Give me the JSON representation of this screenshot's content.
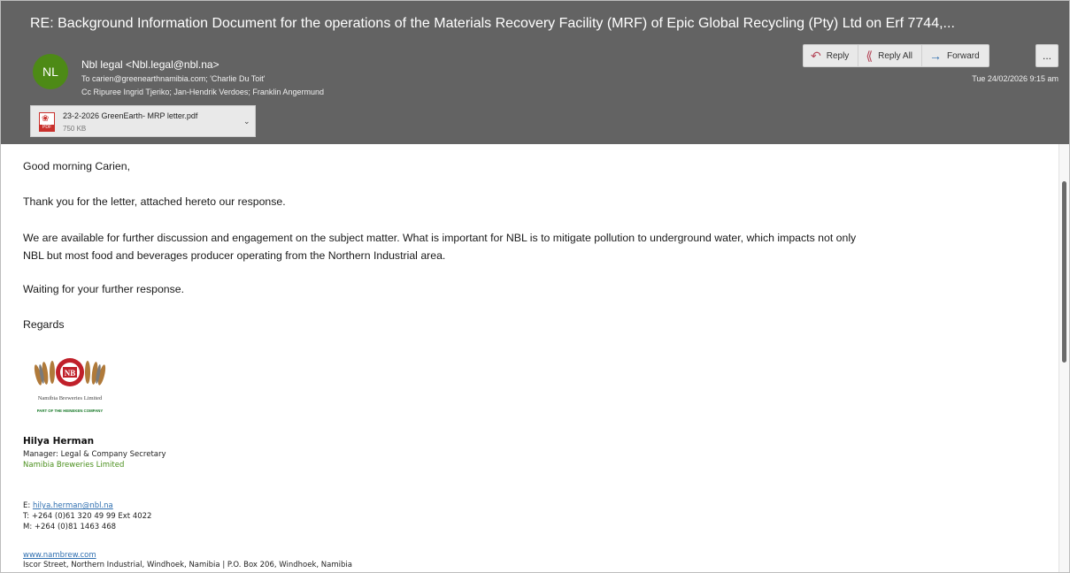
{
  "email": {
    "subject": "RE: Background Information Document for the operations of the Materials Recovery Facility (MRF) of Epic Global Recycling (Pty) Ltd on Erf 7744,...",
    "avatar_initials": "NL",
    "from": "Nbl legal <Nbl.legal@nbl.na>",
    "to": "To  carien@greenearthnamibia.com; 'Charlie Du Toit'",
    "cc": "Cc  Ripuree Ingrid Tjeriko; Jan-Hendrik Verdoes; Franklin Angermund",
    "datetime": "Tue 24/02/2026 9:15 am",
    "attachment": {
      "name": "23-2-2026 GreenEarth- MRP letter.pdf",
      "size": "750 KB",
      "icon": "pdf-icon",
      "type_label": "PDF"
    },
    "actions": {
      "reply": "Reply",
      "reply_all": "Reply All",
      "forward": "Forward",
      "more": "..."
    }
  },
  "body": {
    "greeting": "Good morning Carien,",
    "p1": "Thank you for the letter, attached hereto our response.",
    "p2_line1": "We are available for further discussion and engagement on the subject matter.  What is important for NBL is to mitigate pollution to underground water, which impacts not only",
    "p2_line2": "NBL but most food and beverages producer operating from the Northern Industrial area.",
    "p3": "Waiting for your further response.",
    "closing": "Regards"
  },
  "signature": {
    "logo_text": "Namibia Breweries Limited",
    "logo_tagline": "PART OF THE HEINEKEN COMPANY",
    "name": "Hilya Herman",
    "title": "Manager: Legal & Company Secretary",
    "company": "Namibia Breweries Limited",
    "email_label": "E: ",
    "email": "hilya.herman@nbl.na",
    "tel": "T: +264 (0)61 320 49 99 Ext 4022",
    "mobile": "M: +264 (0)81 1463 468",
    "website": "www.nambrew.com",
    "address": "Iscor Street, Northern Industrial, Windhoek, Namibia | P.O. Box 206, Windhoek, Namibia"
  },
  "colors": {
    "header_bg": "#636363",
    "avatar_bg": "#4d8a16",
    "link": "#2f6fb0",
    "company_green": "#4a8f1c",
    "logo_red": "#c0202a"
  }
}
